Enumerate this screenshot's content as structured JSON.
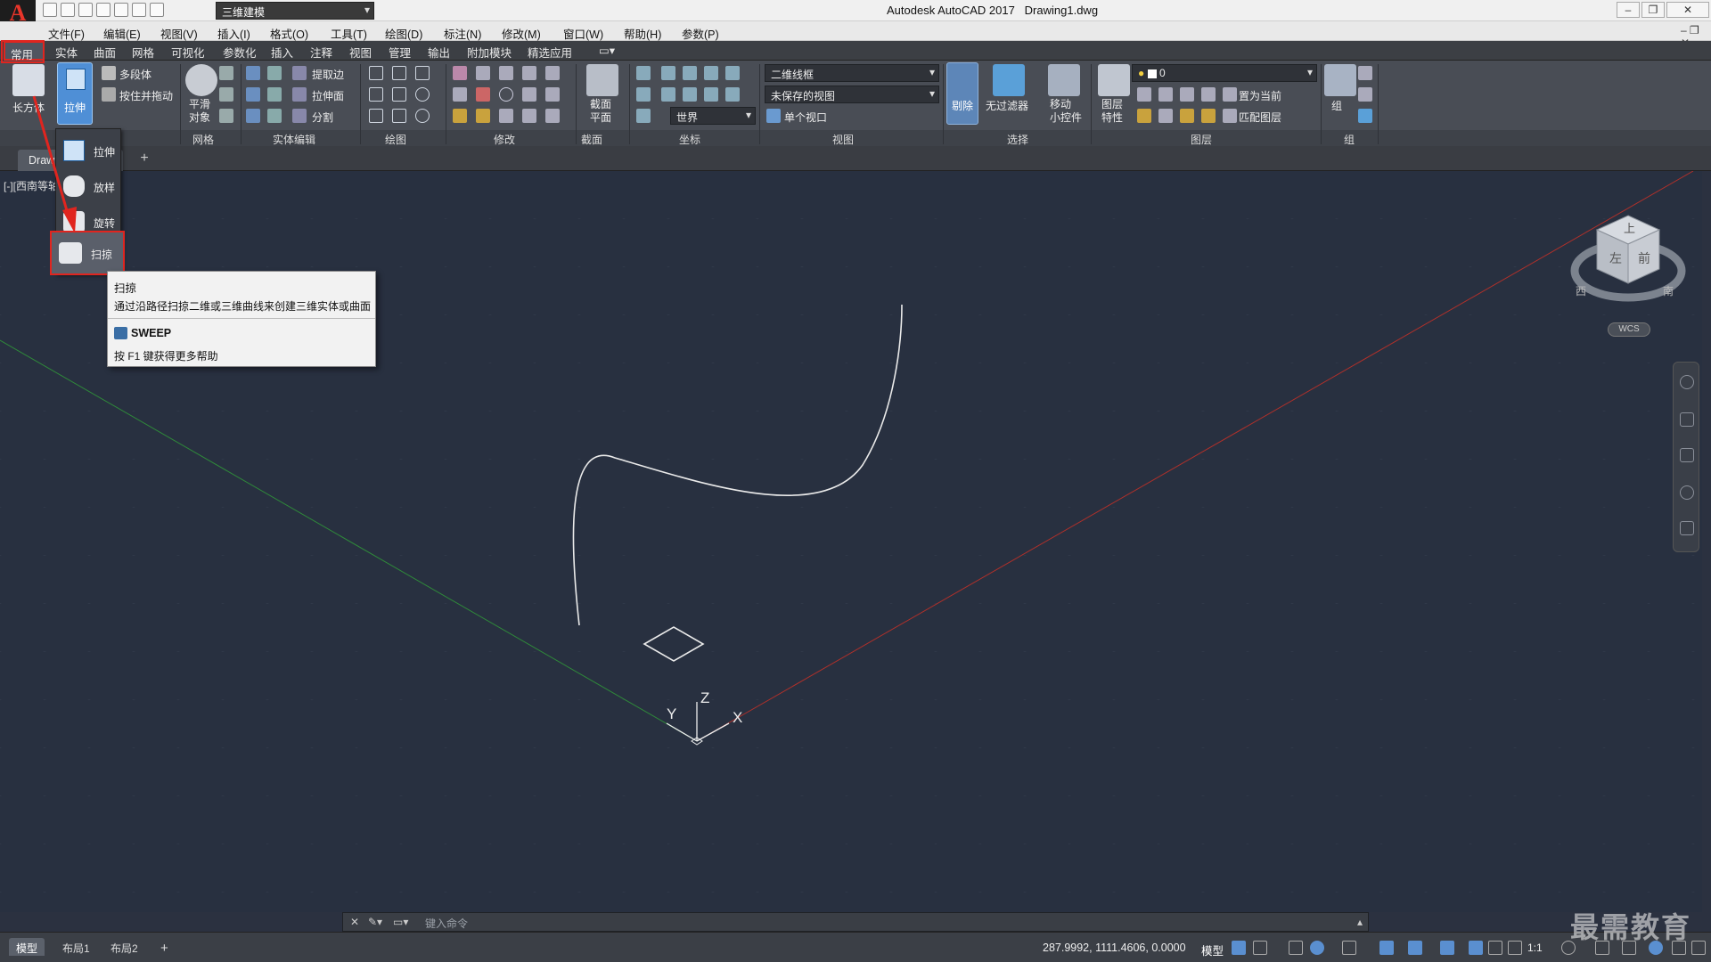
{
  "app": {
    "title": "Autodesk AutoCAD 2017",
    "document": "Drawing1.dwg",
    "logo": "A",
    "workspace": "三维建模"
  },
  "window": {
    "minimize": "–",
    "restore": "❐",
    "close": "✕"
  },
  "menu": [
    "文件(F)",
    "编辑(E)",
    "视图(V)",
    "插入(I)",
    "格式(O)",
    "工具(T)",
    "绘图(D)",
    "标注(N)",
    "修改(M)",
    "窗口(W)",
    "帮助(H)",
    "参数(P)"
  ],
  "ribbon_tabs": [
    "常用",
    "实体",
    "曲面",
    "网格",
    "可视化",
    "参数化",
    "插入",
    "注释",
    "视图",
    "管理",
    "输出",
    "附加模块",
    "精选应用"
  ],
  "ribbon": {
    "modeling": {
      "box": "长方体",
      "extrude": "拉伸",
      "polysolid": "多段体",
      "presspull": "按住并拖动"
    },
    "mesh": {
      "smooth": "平滑\n对象",
      "panel": "网格"
    },
    "solid_edit": {
      "extract_edges": "提取边",
      "extrude_faces": "拉伸面",
      "separate": "分割",
      "panel": "实体编辑"
    },
    "draw": {
      "panel": "绘图"
    },
    "modify": {
      "panel": "修改"
    },
    "section": {
      "plane": "截面\n平面",
      "panel": "截面"
    },
    "coordinates": {
      "world": "世界",
      "panel": "坐标"
    },
    "view": {
      "visual_style": "二维线框",
      "saved_view": "未保存的视图",
      "viewport": "单个视口",
      "panel": "视图"
    },
    "selection": {
      "cull": "剔除",
      "no_filter": "无过滤器",
      "gizmo": "移动\n小控件",
      "panel": "选择"
    },
    "layers": {
      "properties": "图层\n特性",
      "layer_name": "0",
      "set_current": "置为当前",
      "match": "匹配图层",
      "panel": "图层"
    },
    "groups": {
      "group": "组",
      "panel": "组"
    }
  },
  "dropdown": {
    "items": [
      "拉伸",
      "放样",
      "旋转",
      "扫掠"
    ]
  },
  "tooltip": {
    "title": "扫掠",
    "description": "通过沿路径扫掠二维或三维曲线来创建三维实体或曲面",
    "command": "SWEEP",
    "help": "按 F1 键获得更多帮助"
  },
  "doc_tab": {
    "label": "Draw"
  },
  "viewport": {
    "label": "[-][西南等轴测][二维线框]"
  },
  "ucs": {
    "x": "X",
    "y": "Y",
    "z": "Z"
  },
  "viewcube": {
    "top": "上",
    "left": "左",
    "front": "前",
    "west": "西",
    "south": "南",
    "wcs": "WCS"
  },
  "command_line": {
    "placeholder": "键入命令"
  },
  "layout_tabs": [
    "模型",
    "布局1",
    "布局2"
  ],
  "status": {
    "coords": "287.9992, 1111.4606, 0.0000",
    "mode": "模型",
    "scale": "1:1"
  },
  "watermark": "最需教育",
  "colors": {
    "highlight": "#e0251f",
    "accent": "#2e88d6",
    "curve": "#e8e8e8",
    "x_axis": "#c0392b",
    "y_axis": "#2e8b3a"
  }
}
